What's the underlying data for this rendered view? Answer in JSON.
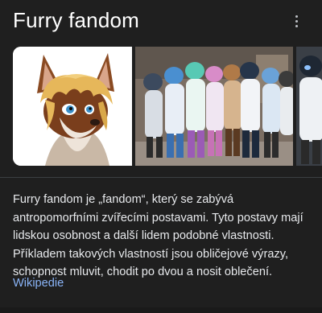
{
  "panel": {
    "title": "Furry fandom",
    "more_icon": "more-vert-icon"
  },
  "gallery": {
    "images": [
      {
        "name": "cartoon-fox-character-image"
      },
      {
        "name": "fursuiters-group-photo"
      },
      {
        "name": "fursuit-partial-image"
      }
    ]
  },
  "description": {
    "text": "Furry fandom je „fandom“, který se zabývá antropomorfními zvířecími postavami. Tyto postavy mají lidskou osobnost a další lidem podobné vlastnosti. Příkladem takových vlastností jsou obličejové výrazy, schopnost mluvit, chodit po dvou a nosit oblečení.",
    "source_link": "Wikipedie"
  },
  "colors": {
    "background": "#1f1f1f",
    "text": "#e8eaed",
    "link": "#8ab4f8",
    "divider": "#3c4043"
  }
}
